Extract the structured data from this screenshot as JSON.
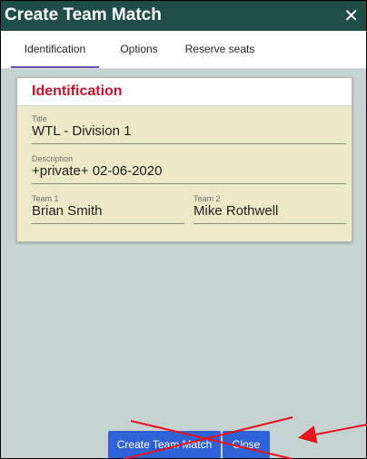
{
  "dialog": {
    "title": "Create Team Match",
    "close_symbol": "✕"
  },
  "tabs": [
    {
      "label": "Identification",
      "active": true
    },
    {
      "label": "Options",
      "active": false
    },
    {
      "label": "Reserve seats",
      "active": false
    }
  ],
  "identification": {
    "heading": "Identification",
    "fields": {
      "title": {
        "label": "Title",
        "value": "WTL - Division 1"
      },
      "description": {
        "label": "Description",
        "value": "+private+ 02-06-2020"
      },
      "team1": {
        "label": "Team 1",
        "value": "Brian Smith"
      },
      "team2": {
        "label": "Team 2",
        "value": "Mike Rothwell"
      }
    }
  },
  "buttons": {
    "create": "Create Team Match",
    "close": "Close"
  },
  "colors": {
    "titlebar": "#1f4d4a",
    "accent_red": "#c8102e",
    "button_blue": "#2f62d6",
    "annotation_red": "#e8141b"
  },
  "icons": {
    "close": "close-icon"
  }
}
